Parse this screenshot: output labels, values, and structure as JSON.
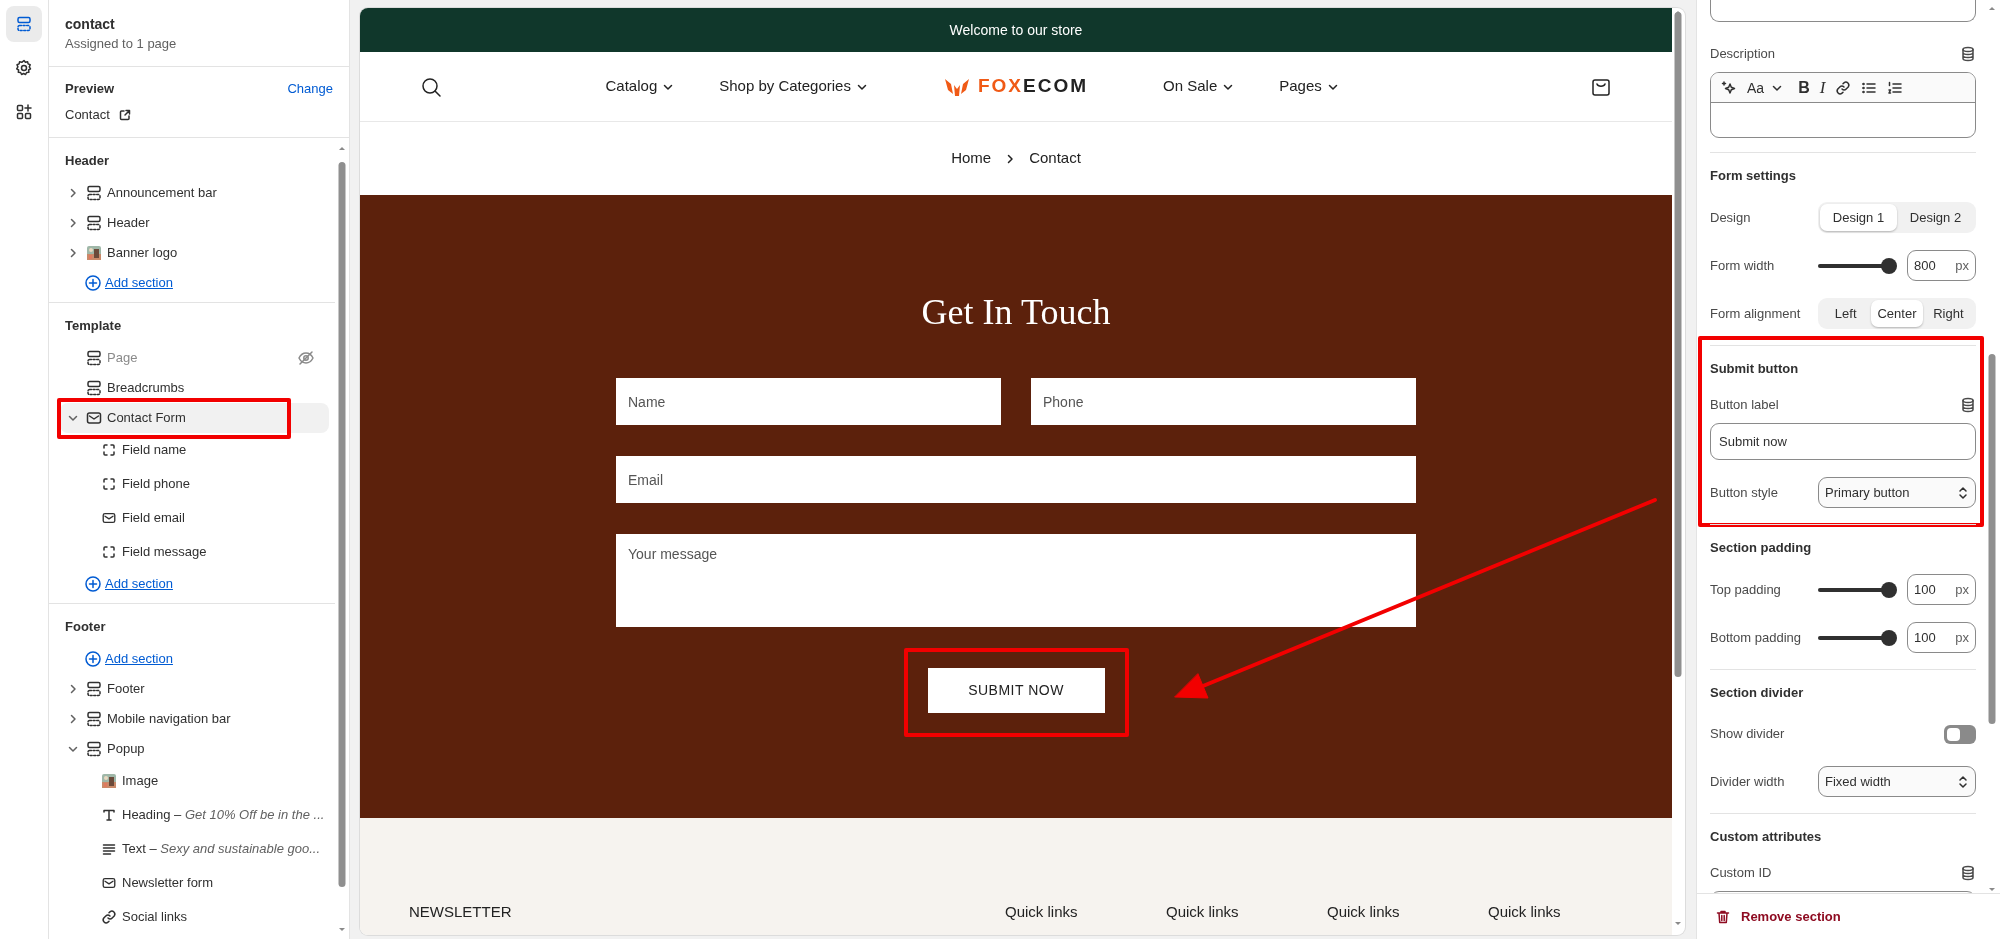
{
  "rail": [
    {
      "kind": "sections",
      "selected": true
    },
    {
      "kind": "settings",
      "selected": false
    },
    {
      "kind": "apps",
      "selected": false
    }
  ],
  "sidebar": {
    "title": "contact",
    "subtitle": "Assigned to 1 page",
    "preview_heading": "Preview",
    "change_link": "Change",
    "preview_page": "Contact",
    "groups": [
      {
        "heading": "Header",
        "items": [
          {
            "kind": "layout",
            "label": "Announcement bar",
            "expanded": false,
            "hidden": false,
            "selected": false,
            "highlighted": false
          },
          {
            "kind": "layout",
            "label": "Header",
            "expanded": false,
            "hidden": false,
            "selected": false,
            "highlighted": false
          },
          {
            "kind": "thumbnail",
            "label": "Banner logo",
            "expanded": false,
            "hidden": false,
            "selected": false,
            "highlighted": false
          },
          {
            "kind": "add",
            "label": "Add section"
          }
        ]
      },
      {
        "heading": "Template",
        "items": [
          {
            "kind": "layout",
            "label": "Page",
            "hidden": true,
            "selected": false,
            "highlighted": false
          },
          {
            "kind": "layout",
            "label": "Breadcrumbs",
            "hidden": false,
            "selected": false,
            "highlighted": false
          },
          {
            "kind": "form",
            "label": "Contact Form",
            "expanded": true,
            "hidden": false,
            "selected": true,
            "highlighted": true,
            "children": [
              {
                "kind": "block",
                "label": "Field name"
              },
              {
                "kind": "block",
                "label": "Field phone"
              },
              {
                "kind": "form",
                "label": "Field email"
              },
              {
                "kind": "block",
                "label": "Field message"
              }
            ]
          },
          {
            "kind": "add",
            "label": "Add section"
          }
        ]
      },
      {
        "heading": "Footer",
        "items": [
          {
            "kind": "add",
            "label": "Add section"
          },
          {
            "kind": "layout",
            "label": "Footer",
            "expanded": false,
            "hidden": false,
            "selected": false,
            "highlighted": false
          },
          {
            "kind": "layout",
            "label": "Mobile navigation bar",
            "expanded": false,
            "hidden": false,
            "selected": false,
            "highlighted": false
          },
          {
            "kind": "layout",
            "label": "Popup",
            "expanded": true,
            "hidden": false,
            "selected": false,
            "highlighted": false,
            "children": [
              {
                "kind": "thumbnail",
                "label": "Image"
              },
              {
                "kind": "heading",
                "label": "Heading – *Get 10% Off be in the ...*"
              },
              {
                "kind": "text",
                "label": "Text – *Sexy and sustainable goo...*"
              },
              {
                "kind": "form",
                "label": "Newsletter form"
              },
              {
                "kind": "link",
                "label": "Social links"
              }
            ]
          }
        ]
      }
    ]
  },
  "preview": {
    "announcement": "Welcome to our store",
    "nav_left": [
      "Catalog",
      "Shop by Categories"
    ],
    "logo": {
      "accent": "FOX",
      "rest": "ECOM"
    },
    "nav_right": [
      "On Sale",
      "Pages"
    ],
    "breadcrumb": [
      "Home",
      "Contact"
    ],
    "form": {
      "title": "Get In Touch",
      "submit": "SUBMIT NOW",
      "submit_highlighted": true,
      "fields": [
        {
          "kind": "short",
          "placeholder": "Name"
        },
        {
          "kind": "short",
          "placeholder": "Phone"
        },
        {
          "kind": "long",
          "placeholder": "Email"
        },
        {
          "kind": "message",
          "placeholder": "Your message"
        }
      ]
    },
    "footer": {
      "newsletter": "NEWSLETTER",
      "columns": [
        "Quick links",
        "Quick links",
        "Quick links",
        "Quick links"
      ]
    }
  },
  "settings": {
    "description": {
      "label": "Description",
      "toolbar": [
        {
          "kind": "sparkle"
        },
        {
          "kind": "font",
          "label": "Aa"
        },
        {
          "kind": "bold",
          "label": "B"
        },
        {
          "kind": "italic",
          "label": "I"
        },
        {
          "kind": "link"
        },
        {
          "kind": "bullets"
        },
        {
          "kind": "numbers"
        }
      ]
    },
    "groups": [
      {
        "heading": "Form settings",
        "highlighted": false,
        "rows": [
          {
            "kind": "segmented",
            "label": "Design",
            "options": [
              {
                "label": "Design 1",
                "selected": true
              },
              {
                "label": "Design 2",
                "selected": false
              }
            ]
          },
          {
            "kind": "range",
            "label": "Form width",
            "level": 1,
            "value": "800",
            "unit": "px"
          },
          {
            "kind": "segmented",
            "label": "Form alignment",
            "options": [
              {
                "label": "Left",
                "selected": false
              },
              {
                "label": "Center",
                "selected": true
              },
              {
                "label": "Right",
                "selected": false
              }
            ]
          }
        ]
      },
      {
        "heading": "Submit button",
        "highlighted": true,
        "rows": [
          {
            "kind": "text",
            "label": "Button label",
            "value": "Submit now"
          },
          {
            "kind": "select",
            "label": "Button style",
            "value": "Primary button"
          }
        ]
      },
      {
        "heading": "Section padding",
        "highlighted": false,
        "rows": [
          {
            "kind": "range",
            "label": "Top padding",
            "level": 1,
            "value": "100",
            "unit": "px"
          },
          {
            "kind": "range",
            "label": "Bottom padding",
            "level": 1,
            "value": "100",
            "unit": "px"
          }
        ]
      },
      {
        "heading": "Section divider",
        "highlighted": false,
        "rows": [
          {
            "kind": "toggle",
            "label": "Show divider",
            "on": false
          },
          {
            "kind": "select",
            "label": "Divider width",
            "value": "Fixed width"
          }
        ]
      },
      {
        "heading": "Custom attributes",
        "highlighted": false,
        "rows": [
          {
            "kind": "text",
            "label": "Custom ID"
          }
        ]
      }
    ],
    "remove": "Remove section"
  },
  "annotations": {
    "arrow": true
  }
}
